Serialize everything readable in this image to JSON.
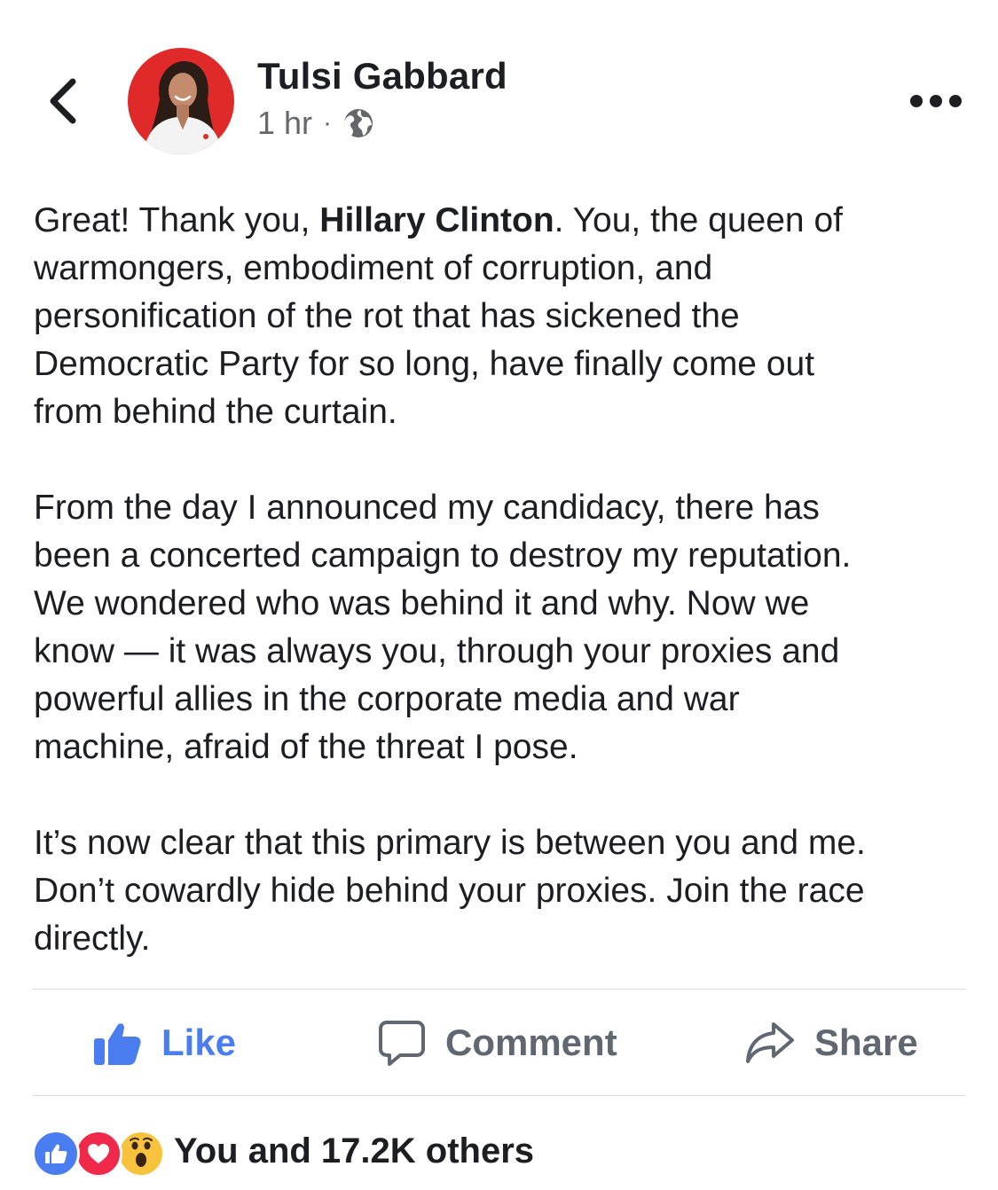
{
  "header": {
    "author_name": "Tulsi Gabbard",
    "timestamp": "1 hr",
    "separator": "·",
    "audience_icon": "globe-icon",
    "back_icon": "chevron-left-icon",
    "more_icon": "more-horizontal-icon"
  },
  "post": {
    "paragraph1": {
      "line1_before": "Great! Thank you, ",
      "mention": "Hillary Clinton",
      "line1_after": ". You, the queen of",
      "line2": "warmongers, embodiment of corruption, and",
      "line3": "personification of the rot that has sickened the",
      "line4": "Democratic Party for so long, have finally come out",
      "line5": "from behind the curtain."
    },
    "paragraph2": {
      "line1": "From the day I announced my candidacy, there has",
      "line2": "been a concerted campaign to destroy my reputation.",
      "line3": "We wondered who was behind it and why. Now we",
      "line4": "know — it was always you, through your proxies and",
      "line5": "powerful allies in the corporate media and war",
      "line6": "machine, afraid of the threat I pose."
    },
    "paragraph3": {
      "line1": "It’s now clear that this primary is between you and me.",
      "line2": "Don’t cowardly hide behind your proxies. Join the race",
      "line3": "directly."
    }
  },
  "actions": {
    "like_label": "Like",
    "comment_label": "Comment",
    "share_label": "Share",
    "like_icon": "thumbs-up-icon",
    "comment_icon": "speech-bubble-icon",
    "share_icon": "share-arrow-icon"
  },
  "reactions": {
    "icons": [
      "like-reaction-icon",
      "love-reaction-icon",
      "wow-reaction-icon"
    ],
    "summary": "You and 17.2K others"
  },
  "colors": {
    "like_blue": "#4a7ef0",
    "love_red": "#f0284a",
    "wow_yellow": "#f7c33c",
    "text_primary": "#1c1e21",
    "text_secondary": "#65676b",
    "divider": "#dadde1",
    "avatar_background": "#e02a2a"
  }
}
